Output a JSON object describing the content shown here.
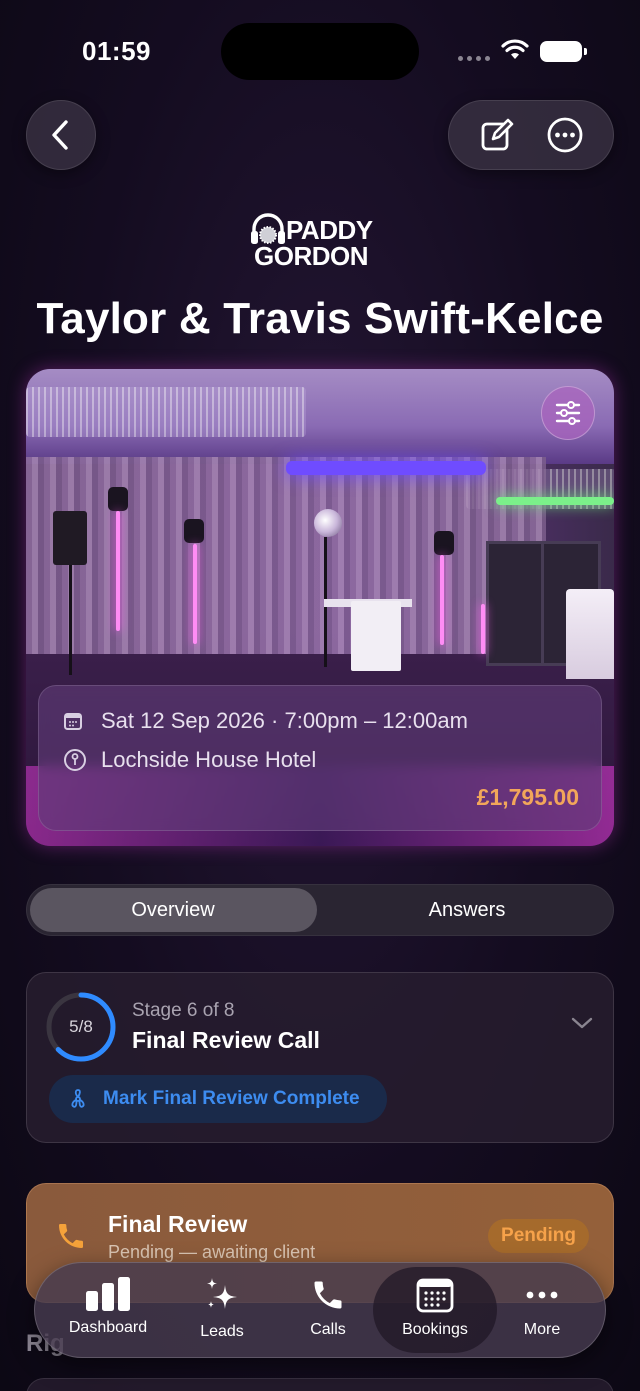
{
  "status_bar": {
    "time": "01:59"
  },
  "brand": {
    "line1": "PADDY",
    "line2": "GORDON"
  },
  "booking": {
    "title": "Taylor & Travis Swift-Kelce",
    "datetime": "Sat 12 Sep 2026 · 7:00pm – 12:00am",
    "venue": "Lochside House Hotel",
    "price": "£1,795.00"
  },
  "segments": {
    "overview": "Overview",
    "answers": "Answers",
    "selected": "Overview"
  },
  "stage": {
    "progress_label": "5/8",
    "progress_fraction": 0.625,
    "subtitle": "Stage 6 of 8",
    "title": "Final Review Call",
    "action_label": "Mark Final Review Complete"
  },
  "review": {
    "title": "Final Review",
    "subtitle": "Pending — awaiting client",
    "status": "Pending"
  },
  "partial_heading": "Rig",
  "tabbar": {
    "items": [
      {
        "label": "Dashboard",
        "icon": "bar-chart-icon"
      },
      {
        "label": "Leads",
        "icon": "sparkles-icon"
      },
      {
        "label": "Calls",
        "icon": "phone-icon"
      },
      {
        "label": "Bookings",
        "icon": "calendar-icon",
        "active": true
      },
      {
        "label": "More",
        "icon": "ellipsis-icon"
      }
    ]
  },
  "colors": {
    "accent_blue": "#3d8cf0",
    "price_orange": "#f2a65a",
    "pending_orange": "#f6a24a"
  }
}
